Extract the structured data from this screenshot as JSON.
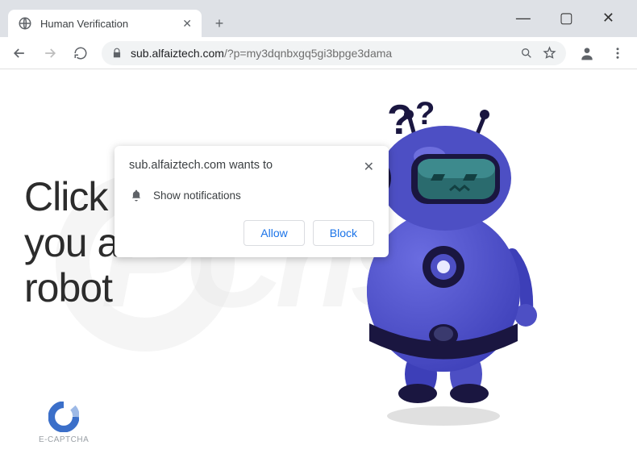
{
  "window": {
    "minimize": "—",
    "maximize": "▢",
    "close": "✕"
  },
  "tab": {
    "title": "Human Verification",
    "close": "✕",
    "new": "+"
  },
  "nav": {
    "back": "←",
    "forward": "→",
    "reload": "⟳"
  },
  "omnibox": {
    "host": "sub.alfaiztech.com",
    "path": "/?p=my3dqnbxgq5gi3bpge3dama"
  },
  "prompt": {
    "origin": "sub.alfaiztech.com wants to",
    "capability": "Show notifications",
    "allow": "Allow",
    "block": "Block",
    "close": "✕"
  },
  "page": {
    "headline": "Click Allow if you are not a robot",
    "captcha_label": "E-CAPTCHA"
  },
  "colors": {
    "accent": "#1a73e8",
    "robot_body": "#4d4fc4",
    "robot_dark": "#202046",
    "robot_visor": "#2a6b6e"
  }
}
